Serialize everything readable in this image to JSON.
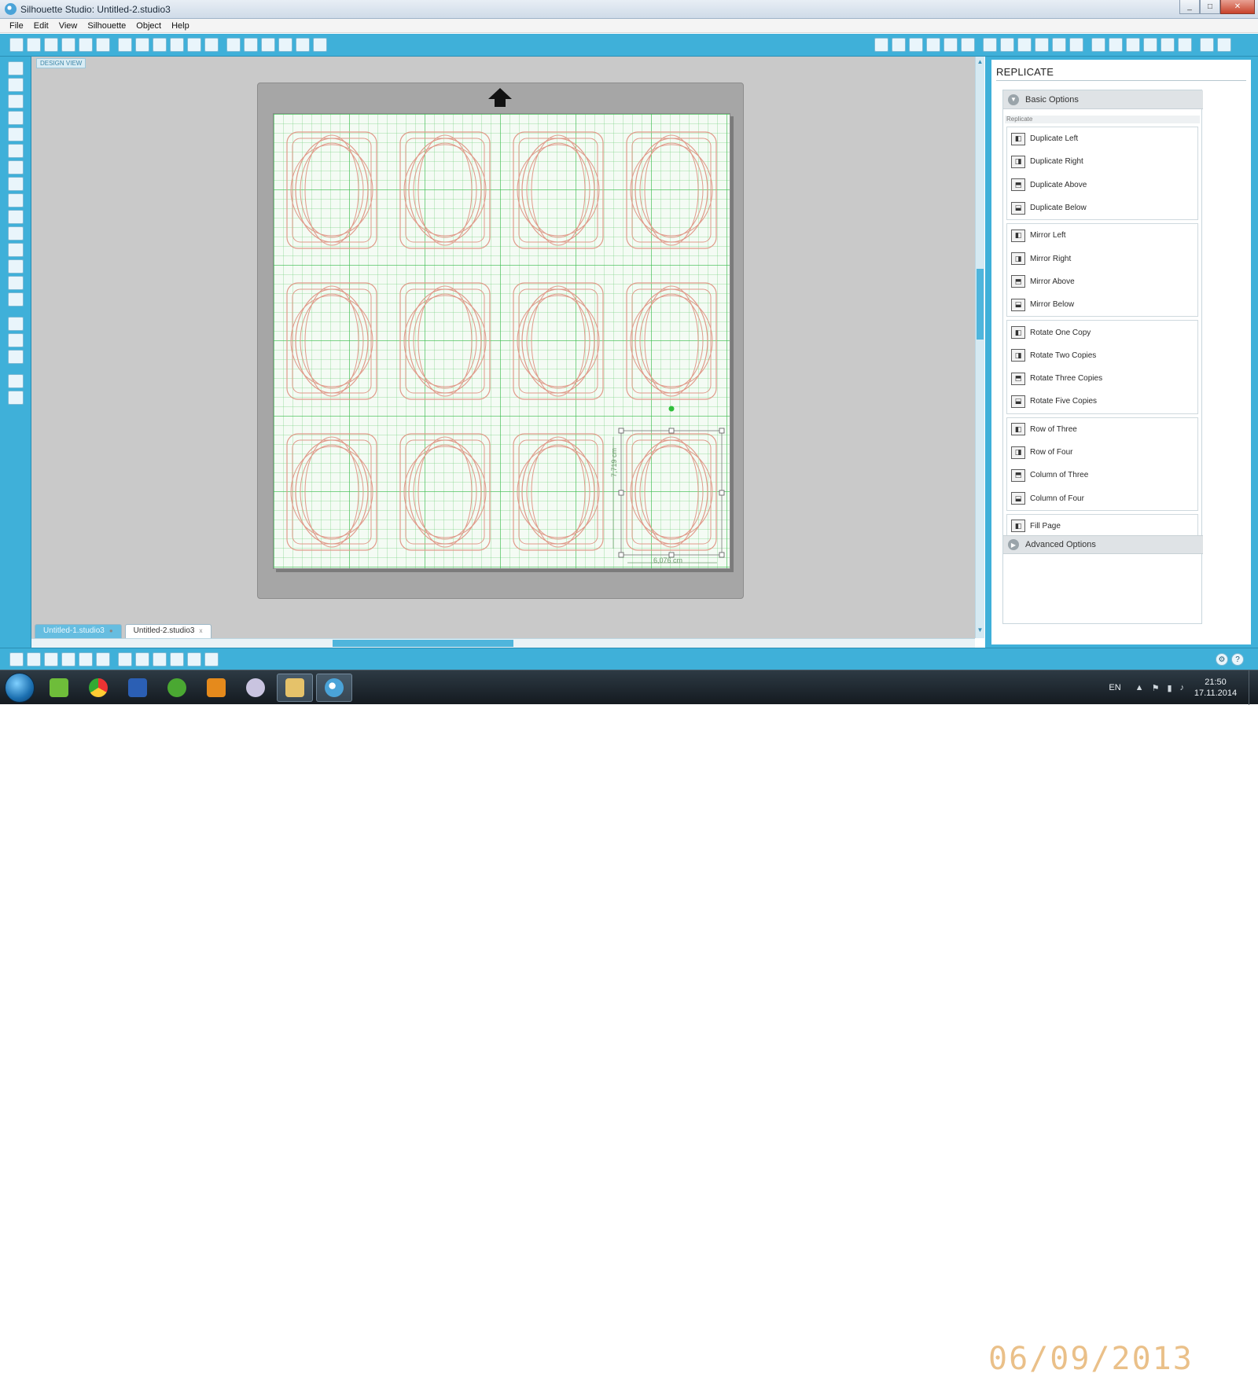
{
  "window": {
    "title": "Silhouette Studio: Untitled-2.studio3",
    "controls": [
      "_",
      "□",
      "✕"
    ]
  },
  "menu": [
    "File",
    "Edit",
    "View",
    "Silhouette",
    "Object",
    "Help"
  ],
  "toolbar": {
    "left_icons": [
      "new-icon",
      "open-icon",
      "template-icon",
      "save-icon",
      "save-as-icon",
      "print-icon",
      "print-cut-icon",
      "copy-icon",
      "paste-icon",
      "cut-icon",
      "undo-icon",
      "redo-icon",
      "pan-icon",
      "zoom-in-icon",
      "zoom-out-icon",
      "zoom-select-icon",
      "drag-zoom-icon",
      "fit-page-icon"
    ],
    "right_icons": [
      "eraser-icon",
      "page-setup-icon",
      "grid-icon",
      "shape-icon",
      "offset-icon",
      "line-style-icon",
      "fill-icon",
      "text-style-icon",
      "transform-icon",
      "rotate-icon",
      "scale-icon",
      "move-icon",
      "replicate-icon",
      "modify-icon",
      "fill-color-icon",
      "cut-settings-icon",
      "send-icon",
      "library-icon",
      "store-icon",
      "register-icon"
    ]
  },
  "left_tools": [
    "select-icon",
    "point-edit-icon",
    "line-icon",
    "rectangle-icon",
    "rounded-rect-icon",
    "ellipse-icon",
    "polygon-icon",
    "curve-icon",
    "freehand-icon",
    "smooth-freehand-icon",
    "arc-icon",
    "regular-polygon-icon",
    "text-icon",
    "eraser-icon",
    "knife-icon",
    "fill-panel-icon",
    "library-icon",
    "store-icon",
    "view-icon",
    "split-view-icon"
  ],
  "workarea": {
    "design_view_label": "DESIGN VIEW",
    "dim_height": "7,719 cm",
    "dim_width": "6,076 cm"
  },
  "tabs": [
    {
      "label": "Untitled-1.studio3",
      "active": false
    },
    {
      "label": "Untitled-2.studio3",
      "active": true
    }
  ],
  "panel": {
    "title": "REPLICATE",
    "basic_options": "Basic Options",
    "replicate_label": "Replicate",
    "groups": [
      [
        "Duplicate Left",
        "Duplicate Right",
        "Duplicate Above",
        "Duplicate Below"
      ],
      [
        "Mirror Left",
        "Mirror Right",
        "Mirror Above",
        "Mirror Below"
      ],
      [
        "Rotate One Copy",
        "Rotate Two Copies",
        "Rotate Three Copies",
        "Rotate Five Copies"
      ],
      [
        "Row of Three",
        "Row of Four",
        "Column of Three",
        "Column of Four"
      ],
      [
        "Fill Page"
      ]
    ],
    "advanced_options": "Advanced Options"
  },
  "taskbar": {
    "lang": "EN",
    "time": "21:50",
    "date": "17.11.2014",
    "watermark": "06/09/2013"
  },
  "colors": {
    "accent": "#3fb0d9",
    "mat": "#a6a6a6",
    "grid": "#3cbe50",
    "shape": "#e09a8a"
  }
}
